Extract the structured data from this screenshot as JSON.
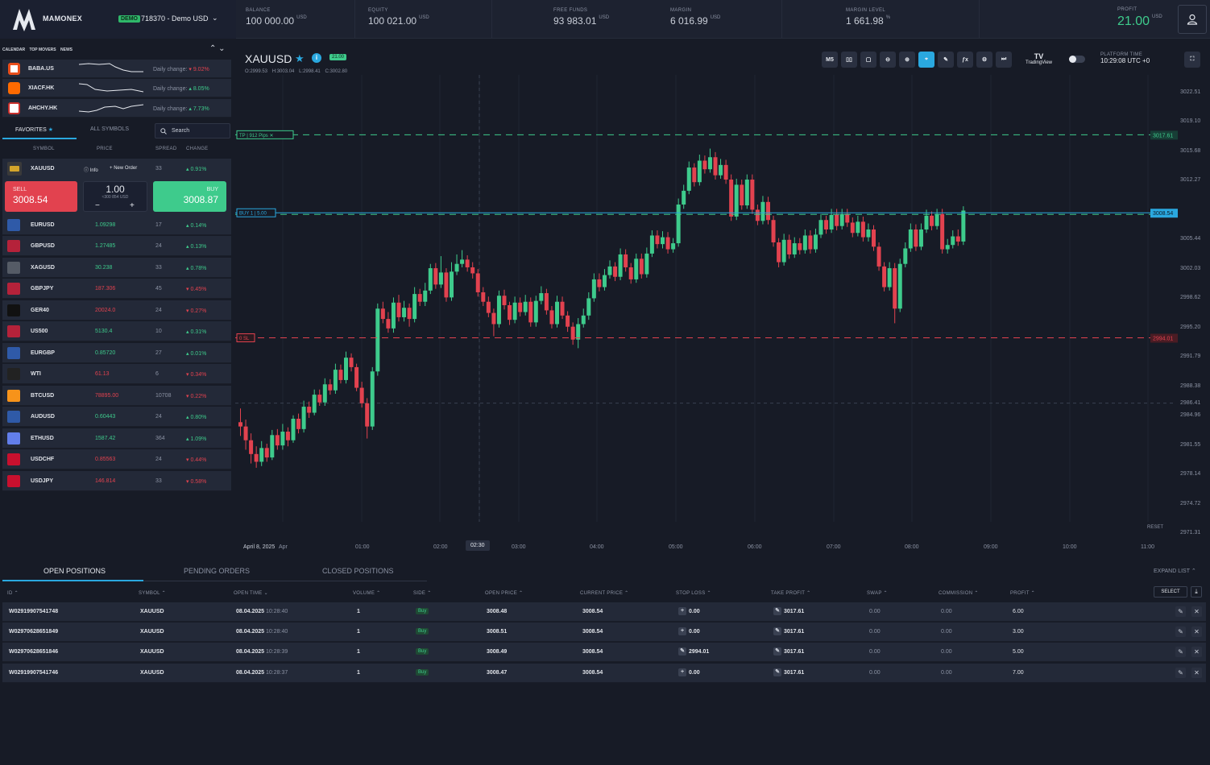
{
  "app": {
    "brand": "MAMONEX",
    "demo_badge": "DEMO",
    "account": "718370 - Demo USD"
  },
  "stats": {
    "balance": {
      "label": "BALANCE",
      "value": "100 000.00",
      "currency": "USD"
    },
    "equity": {
      "label": "EQUITY",
      "value": "100 021.00",
      "currency": "USD"
    },
    "free_funds": {
      "label": "FREE FUNDS",
      "value": "93 983.01",
      "currency": "USD"
    },
    "margin": {
      "label": "MARGIN",
      "value": "6 016.99",
      "currency": "USD"
    },
    "margin_level": {
      "label": "MARGIN LEVEL",
      "value": "1 661.98",
      "currency": "%"
    },
    "profit": {
      "label": "PROFIT",
      "value": "21.00",
      "currency": "USD"
    }
  },
  "left": {
    "tabs": [
      "CALENDAR",
      "TOP MOVERS",
      "NEWS"
    ],
    "movers": [
      {
        "symbol": "BABA.US",
        "label": "Daily change:",
        "change": "9.02%",
        "dir": "down",
        "color": "#e94e1b"
      },
      {
        "symbol": "XIACF.HK",
        "label": "Daily change:",
        "change": "8.05%",
        "dir": "up",
        "color": "#ff6a00"
      },
      {
        "symbol": "AHCHY.HK",
        "label": "Daily change:",
        "change": "7.73%",
        "dir": "up",
        "color": "#c9302c"
      }
    ],
    "subtabs": {
      "favorites": "FAVORITES",
      "all": "ALL SYMBOLS"
    },
    "search_placeholder": "Search",
    "columns": {
      "symbol": "SYMBOL",
      "price": "PRICE",
      "spread": "SPREAD",
      "change": "CHANGE"
    },
    "selected": {
      "symbol": "XAUUSD",
      "spread": "33",
      "change": "0.91%",
      "info": "Info",
      "new_order": "New Order",
      "sell_label": "SELL",
      "sell_price": "3008.54",
      "buy_label": "BUY",
      "buy_price": "3008.87",
      "qty": "1.00",
      "qty_sub": "≈300 854 USD",
      "minus": "−",
      "plus": "+"
    },
    "symbols": [
      {
        "name": "EURUSD",
        "price": "1.09298",
        "spread": "17",
        "change": "0.14%",
        "dir": "up"
      },
      {
        "name": "GBPUSD",
        "price": "1.27485",
        "spread": "24",
        "change": "0.13%",
        "dir": "up"
      },
      {
        "name": "XAGUSD",
        "price": "30.238",
        "spread": "33",
        "change": "0.78%",
        "dir": "up"
      },
      {
        "name": "GBPJPY",
        "price": "187.306",
        "spread": "45",
        "change": "0.45%",
        "dir": "down"
      },
      {
        "name": "GER40",
        "price": "20024.0",
        "spread": "24",
        "change": "0.27%",
        "dir": "down"
      },
      {
        "name": "US500",
        "price": "5130.4",
        "spread": "10",
        "change": "0.31%",
        "dir": "up"
      },
      {
        "name": "EURGBP",
        "price": "0.85720",
        "spread": "27",
        "change": "0.01%",
        "dir": "up"
      },
      {
        "name": "WTI",
        "price": "61.13",
        "spread": "6",
        "change": "0.34%",
        "dir": "down"
      },
      {
        "name": "BTCUSD",
        "price": "78895.00",
        "spread": "10708",
        "change": "0.22%",
        "dir": "down"
      },
      {
        "name": "AUDUSD",
        "price": "0.60443",
        "spread": "24",
        "change": "0.80%",
        "dir": "up"
      },
      {
        "name": "ETHUSD",
        "price": "1587.42",
        "spread": "364",
        "change": "1.09%",
        "dir": "up"
      },
      {
        "name": "USDCHF",
        "price": "0.85563",
        "spread": "24",
        "change": "0.44%",
        "dir": "down"
      },
      {
        "name": "USDJPY",
        "price": "146.814",
        "spread": "33",
        "change": "0.58%",
        "dir": "down"
      }
    ]
  },
  "chart": {
    "symbol": "XAUUSD",
    "price_badge": "21.00",
    "ohlc": {
      "o": "O:2999.53",
      "h": "H:3003.04",
      "l": "L:2998.41",
      "c": "C:3002.80"
    },
    "timeframe": "M5",
    "tradingview": "TradingView",
    "platform_time_label": "PLATFORM TIME",
    "platform_time": "10:29:08 UTC +0",
    "reset": "RESET",
    "tp_label": "TP",
    "tp_pips": "912 Pips",
    "tp_price": "3017.61",
    "buy_label": "BUY",
    "buy_qty": "1",
    "buy_lots": "5.00",
    "current_price": "3008.54",
    "sl_label": "SL",
    "sl_price": "2994.01",
    "y_ticks": [
      "3022.51",
      "3019.10",
      "3015.68",
      "3012.27",
      "3005.44",
      "3002.03",
      "2998.62",
      "2995.20",
      "2991.79",
      "2988.38",
      "2986.41",
      "2984.96",
      "2981.55",
      "2978.14",
      "2974.72",
      "2971.31"
    ],
    "x_ticks": [
      "April 8, 2025",
      "Apr",
      "01:00",
      "02:00",
      "02:30",
      "03:00",
      "04:00",
      "05:00",
      "06:00",
      "07:00",
      "08:00",
      "09:00",
      "10:00",
      "11:00"
    ]
  },
  "chart_data": {
    "type": "candlestick",
    "ylim": [
      2971.31,
      3022.51
    ],
    "bull_color": "#3ecb8c",
    "bear_color": "#e2424f",
    "candles": [
      [
        2984.2,
        2983.7,
        2985.8,
        2982.6
      ],
      [
        2983.7,
        2982.1,
        2984.5,
        2981.0
      ],
      [
        2982.1,
        2980.5,
        2982.9,
        2979.4
      ],
      [
        2980.5,
        2979.6,
        2981.4,
        2978.9
      ],
      [
        2979.6,
        2981.2,
        2982.0,
        2979.1
      ],
      [
        2981.2,
        2980.1,
        2981.7,
        2979.6
      ],
      [
        2980.1,
        2982.7,
        2983.3,
        2979.8
      ],
      [
        2982.7,
        2981.5,
        2983.4,
        2981.0
      ],
      [
        2981.5,
        2983.1,
        2984.0,
        2981.0
      ],
      [
        2983.1,
        2982.1,
        2983.6,
        2981.4
      ],
      [
        2982.1,
        2984.6,
        2985.0,
        2981.8
      ],
      [
        2984.6,
        2983.4,
        2985.2,
        2982.9
      ],
      [
        2983.4,
        2986.0,
        2986.7,
        2983.0
      ],
      [
        2986.0,
        2985.3,
        2986.6,
        2984.7
      ],
      [
        2985.3,
        2987.4,
        2988.0,
        2985.0
      ],
      [
        2987.4,
        2986.5,
        2988.0,
        2986.1
      ],
      [
        2986.5,
        2988.6,
        2989.3,
        2986.1
      ],
      [
        2988.6,
        2987.9,
        2989.2,
        2987.4
      ],
      [
        2987.9,
        2990.3,
        2991.0,
        2987.5
      ],
      [
        2990.3,
        2989.1,
        2990.9,
        2988.7
      ],
      [
        2989.1,
        2991.7,
        2992.4,
        2988.7
      ],
      [
        2991.7,
        2990.6,
        2992.2,
        2990.1
      ],
      [
        2990.6,
        2988.2,
        2991.0,
        2987.8
      ],
      [
        2988.2,
        2986.4,
        2988.9,
        2985.9
      ],
      [
        2986.4,
        2983.7,
        2987.0,
        2982.3
      ],
      [
        2983.7,
        2990.1,
        2990.6,
        2983.3
      ],
      [
        2990.1,
        2997.4,
        2998.0,
        2989.6
      ],
      [
        2997.4,
        2996.2,
        2998.2,
        2995.7
      ],
      [
        2996.2,
        2995.1,
        2997.0,
        2994.6
      ],
      [
        2995.1,
        2998.1,
        2998.7,
        2994.6
      ],
      [
        2998.1,
        2996.4,
        2999.0,
        2995.9
      ],
      [
        2996.4,
        2997.5,
        2998.3,
        2995.9
      ],
      [
        2997.5,
        2996.2,
        2998.0,
        2995.3
      ],
      [
        2996.2,
        2999.1,
        2999.9,
        2995.8
      ],
      [
        2999.1,
        2998.2,
        2999.7,
        2997.7
      ],
      [
        2998.2,
        2999.5,
        3000.4,
        2997.7
      ],
      [
        2999.5,
        3002.1,
        3002.6,
        2999.1
      ],
      [
        3002.1,
        3000.2,
        3002.7,
        2999.7
      ],
      [
        3000.2,
        3001.6,
        3003.5,
        2999.8
      ],
      [
        3001.6,
        2998.7,
        3002.1,
        2998.2
      ],
      [
        2998.7,
        3001.7,
        3002.8,
        2998.3
      ],
      [
        3001.7,
        3002.6,
        3003.7,
        3001.3
      ],
      [
        3002.6,
        3003.1,
        3004.2,
        3002.2
      ],
      [
        3003.1,
        3002.2,
        3003.6,
        3001.7
      ],
      [
        3002.2,
        3001.5,
        3002.8,
        3000.9
      ],
      [
        3001.5,
        2999.3,
        3002.0,
        2998.8
      ],
      [
        2999.3,
        2998.2,
        2999.9,
        2997.7
      ],
      [
        2998.2,
        2996.9,
        2998.8,
        2996.4
      ],
      [
        2996.9,
        2995.6,
        2997.4,
        2994.2
      ],
      [
        2995.6,
        2998.9,
        2999.5,
        2995.2
      ],
      [
        2998.9,
        2997.8,
        2999.6,
        2997.3
      ],
      [
        2997.8,
        2996.1,
        2998.2,
        2995.5
      ],
      [
        2996.1,
        2998.1,
        2998.8,
        2995.7
      ],
      [
        2998.1,
        2997.0,
        2998.7,
        2996.5
      ],
      [
        2997.0,
        2998.2,
        2999.0,
        2996.6
      ],
      [
        2998.2,
        2995.8,
        2998.7,
        2995.3
      ],
      [
        2995.8,
        2998.3,
        2998.9,
        2995.3
      ],
      [
        2998.3,
        2999.2,
        3000.0,
        2997.9
      ],
      [
        2999.2,
        2997.2,
        2999.7,
        2996.7
      ],
      [
        2997.2,
        2995.6,
        2997.7,
        2995.1
      ],
      [
        2995.6,
        2998.2,
        2998.9,
        2995.2
      ],
      [
        2998.2,
        2996.6,
        2998.8,
        2996.2
      ],
      [
        2996.6,
        2995.3,
        2997.1,
        2994.7
      ],
      [
        2995.3,
        2993.8,
        2995.8,
        2993.2
      ],
      [
        2993.8,
        2995.6,
        2996.3,
        2992.8
      ],
      [
        2995.6,
        2996.6,
        2997.4,
        2995.2
      ],
      [
        2996.6,
        2998.6,
        2999.3,
        2996.1
      ],
      [
        2998.6,
        3000.8,
        3001.5,
        2998.2
      ],
      [
        3000.8,
        2999.9,
        3001.5,
        2999.4
      ],
      [
        2999.9,
        3001.3,
        3002.0,
        2999.5
      ],
      [
        3001.3,
        3002.3,
        3003.0,
        3000.9
      ],
      [
        3002.3,
        3001.1,
        3002.8,
        3000.6
      ],
      [
        3001.1,
        3003.7,
        3004.4,
        3000.7
      ],
      [
        3003.7,
        3002.2,
        3004.3,
        3001.7
      ],
      [
        3002.2,
        3000.8,
        3002.7,
        3000.3
      ],
      [
        3000.8,
        3003.2,
        3003.8,
        3000.4
      ],
      [
        3003.2,
        3001.4,
        3003.8,
        3000.9
      ],
      [
        3001.4,
        3003.8,
        3004.5,
        3001.0
      ],
      [
        3003.8,
        3005.9,
        3006.5,
        3003.4
      ],
      [
        3005.9,
        3004.9,
        3006.5,
        3004.4
      ],
      [
        3004.9,
        3005.7,
        3006.4,
        3004.4
      ],
      [
        3005.7,
        3004.3,
        3006.3,
        3003.8
      ],
      [
        3004.3,
        3005.0,
        3005.6,
        3003.9
      ],
      [
        3005.0,
        3009.5,
        3010.2,
        3004.6
      ],
      [
        3009.5,
        3011.1,
        3011.8,
        3009.0
      ],
      [
        3011.1,
        3013.8,
        3014.5,
        3010.7
      ],
      [
        3013.8,
        3012.1,
        3014.3,
        3011.6
      ],
      [
        3012.1,
        3014.6,
        3015.3,
        3011.7
      ],
      [
        3014.6,
        3013.6,
        3015.2,
        3013.1
      ],
      [
        3013.6,
        3015.0,
        3016.0,
        3013.2
      ],
      [
        3015.0,
        3012.9,
        3015.6,
        3012.4
      ],
      [
        3012.9,
        3014.1,
        3014.8,
        3012.5
      ],
      [
        3014.1,
        3012.4,
        3014.7,
        3011.9
      ],
      [
        3012.4,
        3008.1,
        3013.0,
        3007.6
      ],
      [
        3008.1,
        3011.8,
        3012.5,
        3007.7
      ],
      [
        3011.8,
        3009.4,
        3012.4,
        3008.9
      ],
      [
        3009.4,
        3012.4,
        3013.0,
        3009.0
      ],
      [
        3012.4,
        3008.9,
        3013.0,
        3008.4
      ],
      [
        3008.9,
        3007.6,
        3009.5,
        3007.1
      ],
      [
        3007.6,
        3009.8,
        3010.5,
        3007.2
      ],
      [
        3009.8,
        3007.7,
        3010.4,
        3007.2
      ],
      [
        3007.7,
        3005.1,
        3008.2,
        3004.6
      ],
      [
        3005.1,
        3002.8,
        3005.6,
        3002.2
      ],
      [
        3002.8,
        3005.4,
        3006.1,
        3002.4
      ],
      [
        3005.4,
        3003.7,
        3006.0,
        3003.2
      ],
      [
        3003.7,
        3005.0,
        3005.7,
        3003.3
      ],
      [
        3005.0,
        3004.2,
        3005.6,
        3003.7
      ],
      [
        3004.2,
        3005.9,
        3006.6,
        3003.8
      ],
      [
        3005.9,
        3004.3,
        3006.5,
        3003.8
      ],
      [
        3004.3,
        3006.0,
        3006.7,
        3003.9
      ],
      [
        3006.0,
        3007.7,
        3008.4,
        3005.6
      ],
      [
        3007.7,
        3006.6,
        3008.2,
        3006.1
      ],
      [
        3006.6,
        3008.3,
        3009.0,
        3006.2
      ],
      [
        3008.3,
        3007.0,
        3009.0,
        3006.5
      ],
      [
        3007.0,
        3008.4,
        3009.0,
        3006.6
      ],
      [
        3008.4,
        3007.4,
        3009.0,
        3006.9
      ],
      [
        3007.4,
        3006.2,
        3008.0,
        3005.7
      ],
      [
        3006.2,
        3007.5,
        3008.2,
        3005.8
      ],
      [
        3007.5,
        3005.7,
        3008.1,
        3005.2
      ],
      [
        3005.7,
        3006.6,
        3007.3,
        3005.2
      ],
      [
        3006.6,
        3004.6,
        3007.1,
        3004.1
      ],
      [
        3004.6,
        3002.3,
        3005.1,
        3001.8
      ],
      [
        3002.3,
        2999.9,
        3002.8,
        2999.4
      ],
      [
        2999.9,
        3002.1,
        3002.8,
        2999.5
      ],
      [
        3002.1,
        2997.4,
        3002.7,
        2995.7
      ],
      [
        2997.4,
        3002.6,
        3003.2,
        2997.0
      ],
      [
        3002.6,
        3004.4,
        3005.1,
        3002.2
      ],
      [
        3004.4,
        3006.6,
        3007.3,
        3004.0
      ],
      [
        3006.6,
        3004.6,
        3007.2,
        3004.1
      ],
      [
        3004.6,
        3006.6,
        3007.3,
        3004.2
      ],
      [
        3006.6,
        3008.2,
        3008.9,
        3006.2
      ],
      [
        3008.2,
        3007.0,
        3008.7,
        3006.5
      ],
      [
        3007.0,
        3008.4,
        3009.0,
        3006.6
      ],
      [
        3008.4,
        3004.3,
        3009.0,
        3003.8
      ],
      [
        3004.3,
        3004.8,
        3005.5,
        3003.8
      ],
      [
        3004.8,
        3005.8,
        3006.5,
        3004.4
      ],
      [
        3005.8,
        3005.2,
        3006.6,
        3004.7
      ],
      [
        3005.2,
        3008.8,
        3009.3,
        3004.8
      ]
    ]
  },
  "bottom": {
    "tabs": [
      "OPEN POSITIONS",
      "PENDING ORDERS",
      "CLOSED POSITIONS"
    ],
    "expand": "EXPAND LIST",
    "select": "SELECT",
    "columns": [
      "ID",
      "SYMBOL",
      "OPEN TIME",
      "VOLUME",
      "SIDE",
      "OPEN PRICE",
      "CURRENT PRICE",
      "STOP LOSS",
      "TAKE PROFIT",
      "SWAP",
      "COMMISSION",
      "PROFIT"
    ],
    "rows": [
      {
        "id": "W02919907541748",
        "symbol": "XAUUSD",
        "date": "08.04.2025",
        "time": "10:28:40",
        "volume": "1",
        "side": "Buy",
        "open": "3008.48",
        "current": "3008.54",
        "sl": "0.00",
        "tp": "3017.61",
        "swap": "0.00",
        "commission": "0.00",
        "profit": "6.00"
      },
      {
        "id": "W02970628651849",
        "symbol": "XAUUSD",
        "date": "08.04.2025",
        "time": "10:28:40",
        "volume": "1",
        "side": "Buy",
        "open": "3008.51",
        "current": "3008.54",
        "sl": "0.00",
        "tp": "3017.61",
        "swap": "0.00",
        "commission": "0.00",
        "profit": "3.00"
      },
      {
        "id": "W02970628651846",
        "symbol": "XAUUSD",
        "date": "08.04.2025",
        "time": "10:28:39",
        "volume": "1",
        "side": "Buy",
        "open": "3008.49",
        "current": "3008.54",
        "sl": "2994.01",
        "tp": "3017.61",
        "swap": "0.00",
        "commission": "0.00",
        "profit": "5.00"
      },
      {
        "id": "W02919907541746",
        "symbol": "XAUUSD",
        "date": "08.04.2025",
        "time": "10:28:37",
        "volume": "1",
        "side": "Buy",
        "open": "3008.47",
        "current": "3008.54",
        "sl": "0.00",
        "tp": "3017.61",
        "swap": "0.00",
        "commission": "0.00",
        "profit": "7.00"
      }
    ]
  }
}
